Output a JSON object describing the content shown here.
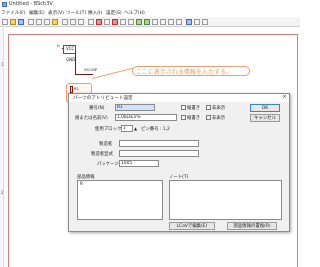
{
  "window": {
    "title": "Untitled - BSch3V"
  },
  "menubar": {
    "items": [
      "ファイル(F)",
      "編集(E)",
      "表示(V)",
      "ツール(T)",
      "挿入(I)",
      "設定(S)",
      "ヘルプ(H)"
    ]
  },
  "ruler": {
    "ticks": [
      "1",
      "2"
    ]
  },
  "schematic": {
    "vcc_part": "VCC",
    "gnd_label": "GND",
    "vcc_net_label": "VCCHP",
    "header_label": "H",
    "resistor_ref": "R1",
    "resistor_value": "1.0kΩ±5%"
  },
  "callout": {
    "text": "ここに表示される情報を入力する。"
  },
  "dialog": {
    "title": "パーツのアトリビュート設定",
    "close": "×",
    "ref_label": "番号(N)",
    "ref_value": "R1",
    "value_label": "値または名前(V)",
    "value_value": "1.0kΩ±5%",
    "vertical_label": "縦書き",
    "hidden_label": "非表示",
    "ok_label": "OK",
    "cancel_label": "キャンセル",
    "block_label": "使用ブロック",
    "block_value": "1",
    "pin_label": "ピン番号 : 1,2",
    "maker_label": "製造者",
    "maker_value": "",
    "model_label": "製造者型式",
    "model_value": "",
    "package_label": "パッケージ",
    "package_value": "1005",
    "part_info_label": "部品情報",
    "part_info_value": "R",
    "note_label": "ノート(T)",
    "lcov_button": "LCoVで編集(E)",
    "replace_button": "部品情報の置換(R)"
  }
}
